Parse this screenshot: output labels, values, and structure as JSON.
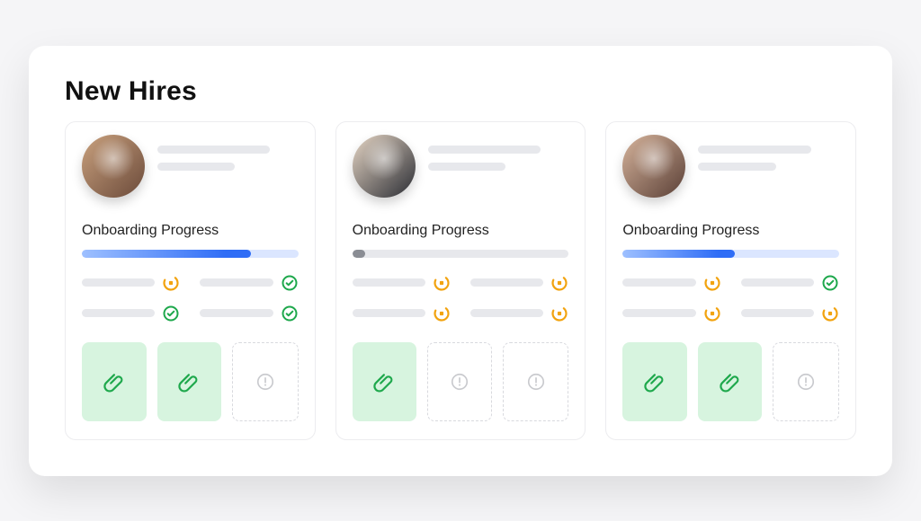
{
  "title": "New Hires",
  "section_label": "Onboarding Progress",
  "status": {
    "pending": "pending",
    "done": "done",
    "none": "none"
  },
  "colors": {
    "progress_blue": "#2f6df6",
    "progress_track_blue": "#dbe6ff",
    "progress_gray": "#8a8d94",
    "pending_ring": "#f2a30f",
    "done_ring": "#1ea84c",
    "attachment_fill": "#d7f4df",
    "attachment_clip": "#1ea84c",
    "empty_alert": "#c9cace"
  },
  "hires": [
    {
      "avatar_colors": [
        "#c9a17e",
        "#6b4a3a"
      ],
      "progress_percent": 78,
      "progress_style": "blue",
      "tasks": [
        {
          "status": "pending"
        },
        {
          "status": "done"
        },
        {
          "status": "done"
        },
        {
          "status": "done"
        }
      ],
      "attachments": [
        "filled",
        "filled",
        "empty"
      ]
    },
    {
      "avatar_colors": [
        "#e6d6c5",
        "#2a2c33"
      ],
      "progress_percent": 6,
      "progress_style": "gray",
      "tasks": [
        {
          "status": "pending"
        },
        {
          "status": "pending"
        },
        {
          "status": "pending"
        },
        {
          "status": "pending"
        }
      ],
      "attachments": [
        "filled",
        "empty",
        "empty"
      ]
    },
    {
      "avatar_colors": [
        "#d6b49c",
        "#5a3f36"
      ],
      "progress_percent": 52,
      "progress_style": "blue",
      "tasks": [
        {
          "status": "pending"
        },
        {
          "status": "done"
        },
        {
          "status": "pending"
        },
        {
          "status": "pending"
        }
      ],
      "attachments": [
        "filled",
        "filled",
        "empty"
      ]
    }
  ]
}
